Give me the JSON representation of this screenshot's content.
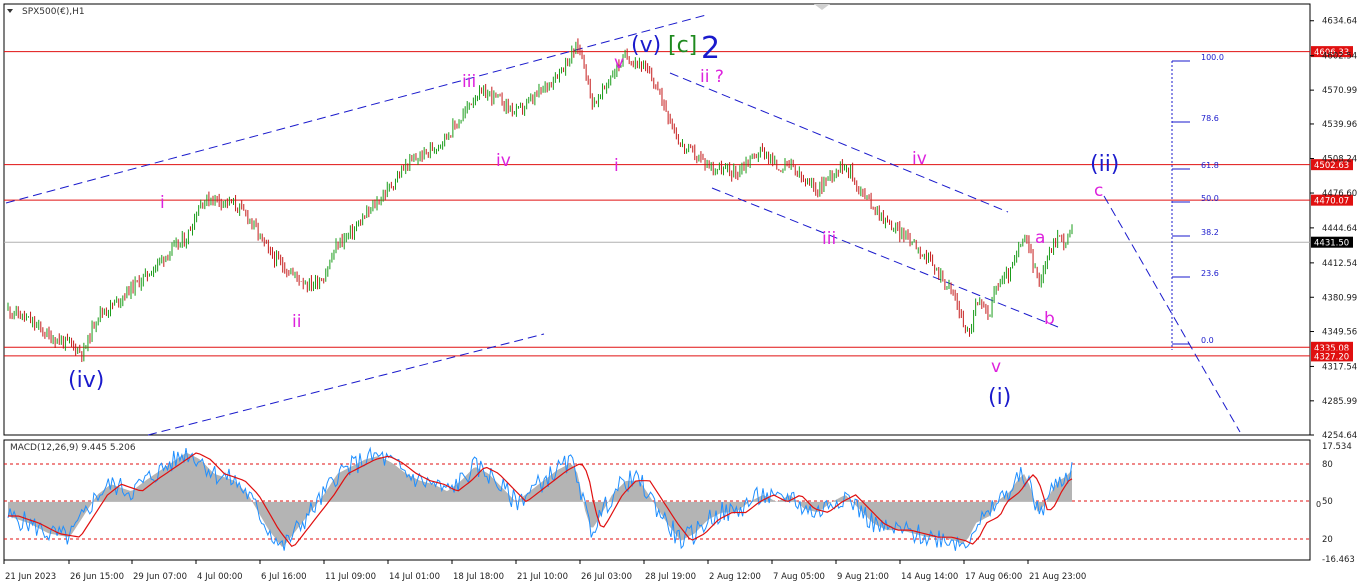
{
  "window": {
    "symbol_label": "SPX500(€),H1",
    "macd_label": "MACD(12,26,9) 9.445 5.206"
  },
  "colors": {
    "background": "#ffffff",
    "bull_candle": "#1a9c1a",
    "bear_candle": "#c41a1a",
    "hline": "#e01010",
    "wave_blue": "#1a1acc",
    "wave_magenta": "#dd22dd",
    "wave_green": "#1f8a1f",
    "fib": "#1a1acc",
    "macd_hist": "#b4b4b4",
    "macd_line": "#1f8fff",
    "signal_line": "#e01010",
    "grid": "#b0b0b0"
  },
  "chart_data": [
    {
      "type": "candlestick",
      "title": "SPX500(€),H1",
      "ylim": [
        4254.64,
        4650
      ],
      "y_ticks": [
        "4634.64",
        "4602.54",
        "4570.99",
        "4539.96",
        "4508.24",
        "4476.60",
        "4444.64",
        "4412.54",
        "4380.99",
        "4349.56",
        "4317.54",
        "4285.99",
        "4254.64"
      ],
      "x_ticks": [
        "21 Jun 2023",
        "26 Jun 15:00",
        "29 Jun 07:00",
        "4 Jul 00:00",
        "6 Jul 16:00",
        "11 Jul 09:00",
        "14 Jul 01:00",
        "18 Jul 18:00",
        "21 Jul 10:00",
        "26 Jul 03:00",
        "28 Jul 19:00",
        "2 Aug 12:00",
        "7 Aug 05:00",
        "9 Aug 21:00",
        "14 Aug 14:00",
        "17 Aug 06:00",
        "21 Aug 23:00"
      ],
      "path_points": [
        [
          0,
          4370
        ],
        [
          6,
          4360
        ],
        [
          12,
          4345
        ],
        [
          18,
          4338
        ],
        [
          22,
          4330
        ],
        [
          26,
          4365
        ],
        [
          30,
          4372
        ],
        [
          36,
          4390
        ],
        [
          40,
          4400
        ],
        [
          46,
          4420
        ],
        [
          52,
          4435
        ],
        [
          56,
          4468
        ],
        [
          60,
          4472
        ],
        [
          66,
          4466
        ],
        [
          70,
          4455
        ],
        [
          76,
          4422
        ],
        [
          80,
          4410
        ],
        [
          84,
          4400
        ],
        [
          88,
          4392
        ],
        [
          92,
          4400
        ],
        [
          96,
          4430
        ],
        [
          100,
          4440
        ],
        [
          104,
          4455
        ],
        [
          108,
          4470
        ],
        [
          112,
          4485
        ],
        [
          116,
          4502
        ],
        [
          120,
          4510
        ],
        [
          124,
          4518
        ],
        [
          128,
          4530
        ],
        [
          132,
          4545
        ],
        [
          136,
          4566
        ],
        [
          140,
          4568
        ],
        [
          144,
          4560
        ],
        [
          148,
          4550
        ],
        [
          152,
          4560
        ],
        [
          156,
          4572
        ],
        [
          160,
          4586
        ],
        [
          164,
          4602
        ],
        [
          166,
          4612
        ],
        [
          168,
          4595
        ],
        [
          170,
          4560
        ],
        [
          172,
          4562
        ],
        [
          176,
          4586
        ],
        [
          180,
          4602
        ],
        [
          184,
          4596
        ],
        [
          188,
          4580
        ],
        [
          192,
          4552
        ],
        [
          196,
          4520
        ],
        [
          200,
          4512
        ],
        [
          204,
          4502
        ],
        [
          208,
          4498
        ],
        [
          212,
          4495
        ],
        [
          216,
          4508
        ],
        [
          220,
          4516
        ],
        [
          224,
          4500
        ],
        [
          228,
          4502
        ],
        [
          232,
          4486
        ],
        [
          236,
          4480
        ],
        [
          240,
          4495
        ],
        [
          244,
          4504
        ],
        [
          248,
          4480
        ],
        [
          252,
          4465
        ],
        [
          256,
          4450
        ],
        [
          260,
          4440
        ],
        [
          264,
          4432
        ],
        [
          268,
          4415
        ],
        [
          272,
          4400
        ],
        [
          276,
          4380
        ],
        [
          278,
          4360
        ],
        [
          280,
          4346
        ],
        [
          282,
          4375
        ],
        [
          286,
          4368
        ],
        [
          288,
          4392
        ],
        [
          292,
          4404
        ],
        [
          294,
          4420
        ],
        [
          296,
          4436
        ],
        [
          298,
          4422
        ],
        [
          300,
          4394
        ],
        [
          302,
          4410
        ],
        [
          304,
          4426
        ],
        [
          306,
          4438
        ],
        [
          308,
          4430
        ],
        [
          310,
          4444
        ]
      ],
      "horizontal_lines": [
        {
          "value": 4606.33,
          "label": "4606.33"
        },
        {
          "value": 4502.63,
          "label": "4502.63"
        },
        {
          "value": 4470.07,
          "label": "4470.07"
        },
        {
          "value": 4431.5,
          "label": "4431.50",
          "style": "current"
        },
        {
          "value": 4335.08,
          "label": "4335.08"
        },
        {
          "value": 4327.2,
          "label": "4327.20"
        }
      ],
      "fib_levels": [
        "100.0",
        "78.6",
        "61.8",
        "50.0",
        "38.2",
        "23.6",
        "0.0"
      ],
      "wave_labels": [
        {
          "text": "(iv)",
          "color": "blue"
        },
        {
          "text": "i",
          "color": "magenta"
        },
        {
          "text": "ii",
          "color": "magenta"
        },
        {
          "text": "iii",
          "color": "magenta"
        },
        {
          "text": "iv",
          "color": "magenta"
        },
        {
          "text": "v",
          "color": "magenta"
        },
        {
          "text": "i",
          "color": "magenta"
        },
        {
          "text": "(v)",
          "color": "blue"
        },
        {
          "text": "[c]",
          "color": "green"
        },
        {
          "text": "2",
          "color": "blue"
        },
        {
          "text": "ii ?",
          "color": "magenta"
        },
        {
          "text": "iii",
          "color": "magenta"
        },
        {
          "text": "iv",
          "color": "magenta"
        },
        {
          "text": "v",
          "color": "magenta"
        },
        {
          "text": "(i)",
          "color": "blue"
        },
        {
          "text": "a",
          "color": "magenta"
        },
        {
          "text": "b",
          "color": "magenta"
        },
        {
          "text": "c",
          "color": "magenta"
        },
        {
          "text": "(ii)",
          "color": "blue"
        }
      ]
    },
    {
      "type": "area",
      "title": "MACD(12,26,9) 9.445 5.206",
      "ylim": [
        -16.463,
        17.534
      ],
      "y_ticks": [
        "17.534",
        "80",
        "50",
        "20",
        "-16.463"
      ],
      "y_tick_extra": [
        "0"
      ],
      "levels": [
        80,
        50,
        20
      ],
      "hist_points": [
        [
          0,
          -4
        ],
        [
          6,
          -6
        ],
        [
          12,
          -9
        ],
        [
          18,
          -10
        ],
        [
          22,
          -4
        ],
        [
          26,
          2
        ],
        [
          30,
          5
        ],
        [
          36,
          3
        ],
        [
          40,
          6
        ],
        [
          46,
          10
        ],
        [
          52,
          14
        ],
        [
          56,
          12
        ],
        [
          60,
          8
        ],
        [
          66,
          6
        ],
        [
          70,
          2
        ],
        [
          76,
          -8
        ],
        [
          80,
          -13
        ],
        [
          84,
          -8
        ],
        [
          88,
          -3
        ],
        [
          92,
          2
        ],
        [
          96,
          8
        ],
        [
          100,
          10
        ],
        [
          104,
          12
        ],
        [
          108,
          13
        ],
        [
          112,
          11
        ],
        [
          116,
          8
        ],
        [
          120,
          6
        ],
        [
          124,
          5
        ],
        [
          128,
          3
        ],
        [
          132,
          6
        ],
        [
          136,
          10
        ],
        [
          140,
          8
        ],
        [
          144,
          4
        ],
        [
          148,
          0
        ],
        [
          152,
          3
        ],
        [
          156,
          6
        ],
        [
          160,
          9
        ],
        [
          164,
          11
        ],
        [
          166,
          8
        ],
        [
          168,
          -2
        ],
        [
          170,
          -8
        ],
        [
          172,
          -5
        ],
        [
          176,
          2
        ],
        [
          180,
          6
        ],
        [
          184,
          6
        ],
        [
          188,
          0
        ],
        [
          192,
          -6
        ],
        [
          196,
          -11
        ],
        [
          200,
          -9
        ],
        [
          204,
          -5
        ],
        [
          208,
          -3
        ],
        [
          212,
          -3
        ],
        [
          216,
          0
        ],
        [
          220,
          2
        ],
        [
          224,
          0
        ],
        [
          228,
          2
        ],
        [
          232,
          -2
        ],
        [
          236,
          -3
        ],
        [
          240,
          0
        ],
        [
          244,
          2
        ],
        [
          248,
          -2
        ],
        [
          252,
          -6
        ],
        [
          256,
          -8
        ],
        [
          260,
          -8
        ],
        [
          264,
          -9
        ],
        [
          268,
          -10
        ],
        [
          272,
          -10
        ],
        [
          276,
          -11
        ],
        [
          278,
          -12
        ],
        [
          280,
          -10
        ],
        [
          282,
          -6
        ],
        [
          286,
          -4
        ],
        [
          288,
          0
        ],
        [
          292,
          3
        ],
        [
          294,
          6
        ],
        [
          296,
          8
        ],
        [
          298,
          4
        ],
        [
          300,
          -3
        ],
        [
          302,
          -1
        ],
        [
          304,
          3
        ],
        [
          306,
          6
        ],
        [
          308,
          7
        ],
        [
          310,
          9
        ]
      ]
    }
  ]
}
